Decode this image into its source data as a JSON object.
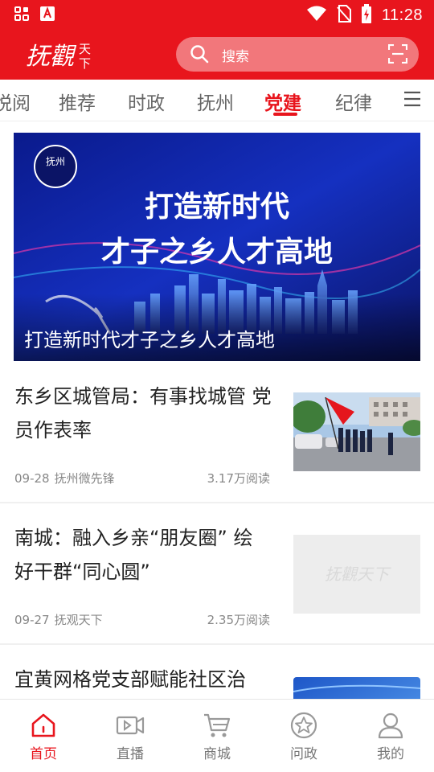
{
  "status_bar": {
    "time": "11:28"
  },
  "header": {
    "logo_text": "抚觀天下",
    "search_placeholder": "搜索"
  },
  "channels": {
    "items": [
      "悦阅",
      "推荐",
      "时政",
      "抚州",
      "党建",
      "纪律"
    ],
    "active": "党建"
  },
  "banner": {
    "headline_line1": "打造新时代",
    "headline_line2": "才子之乡人才高地",
    "caption": "打造新时代才子之乡人才高地",
    "badge_text": "抚州"
  },
  "articles": [
    {
      "title": "东乡区城管局：有事找城管 党员作表率",
      "date": "09-28",
      "source": "抚州微先锋",
      "reads": "3.17万阅读",
      "thumb": "photo"
    },
    {
      "title": "南城：融入乡亲“朋友圈” 绘好干群“同心圆”",
      "date": "09-27",
      "source": "抚观天下",
      "reads": "2.35万阅读",
      "thumb": "placeholder",
      "thumb_text": "抚觀天下"
    },
    {
      "title": "宜黄网格党支部赋能社区治",
      "thumb": "blue"
    }
  ],
  "bottom_nav": {
    "items": [
      {
        "label": "首页",
        "icon": "home-icon",
        "active": true
      },
      {
        "label": "直播",
        "icon": "video-icon",
        "active": false
      },
      {
        "label": "商城",
        "icon": "cart-icon",
        "active": false
      },
      {
        "label": "问政",
        "icon": "star-icon",
        "active": false
      },
      {
        "label": "我的",
        "icon": "user-icon",
        "active": false
      }
    ]
  },
  "colors": {
    "brand_red": "#e8151d",
    "text_dark": "#222222",
    "text_meta": "#888888"
  }
}
